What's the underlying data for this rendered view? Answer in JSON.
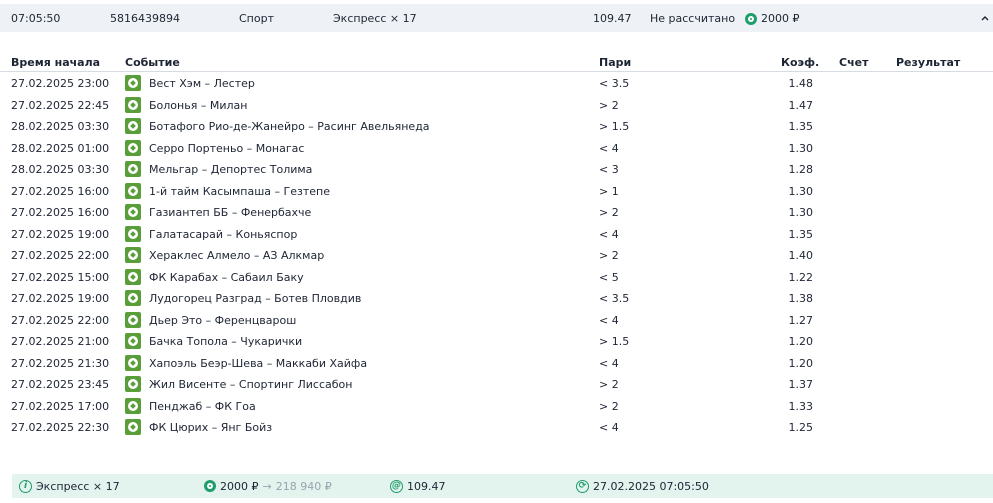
{
  "summary": {
    "time": "07:05:50",
    "bet_id": "5816439894",
    "sport": "Спорт",
    "bet_type": "Экспресс × 17",
    "coef": "109.47",
    "status": "Не рассчитано",
    "stake": "2000 ₽",
    "stake_icon": "coin-icon",
    "collapse_icon": "chevron-up-icon"
  },
  "table": {
    "headers": {
      "time": "Время начала",
      "event": "Событие",
      "bet": "Пари",
      "coef": "Коэф.",
      "score": "Счет",
      "result": "Результат"
    },
    "rows": [
      {
        "time": "27.02.2025 23:00",
        "event": "Вест Хэм – Лестер",
        "bet": "< 3.5",
        "coef": "1.48"
      },
      {
        "time": "27.02.2025 22:45",
        "event": "Болонья – Милан",
        "bet": "> 2",
        "coef": "1.47"
      },
      {
        "time": "28.02.2025 03:30",
        "event": "Ботафого Рио-де-Жанейро – Расинг Авельянеда",
        "bet": "> 1.5",
        "coef": "1.35"
      },
      {
        "time": "28.02.2025 01:00",
        "event": "Серро Портеньо – Монагас",
        "bet": "< 4",
        "coef": "1.30"
      },
      {
        "time": "28.02.2025 03:30",
        "event": "Мельгар – Депортес Толима",
        "bet": "< 3",
        "coef": "1.28"
      },
      {
        "time": "27.02.2025 16:00",
        "event": "1-й тайм Касымпаша – Гезтепе",
        "bet": "> 1",
        "coef": "1.30"
      },
      {
        "time": "27.02.2025 16:00",
        "event": "Газиантеп ББ – Фенербахче",
        "bet": "> 2",
        "coef": "1.30"
      },
      {
        "time": "27.02.2025 19:00",
        "event": "Галатасарай – Коньяспор",
        "bet": "< 4",
        "coef": "1.35"
      },
      {
        "time": "27.02.2025 22:00",
        "event": "Хераклес Алмело – АЗ Алкмар",
        "bet": "> 2",
        "coef": "1.40"
      },
      {
        "time": "27.02.2025 15:00",
        "event": "ФК Карабах – Сабаил Баку",
        "bet": "< 5",
        "coef": "1.22"
      },
      {
        "time": "27.02.2025 19:00",
        "event": "Лудогорец Разград – Ботев Пловдив",
        "bet": "< 3.5",
        "coef": "1.38"
      },
      {
        "time": "27.02.2025 22:00",
        "event": "Дьер Это – Ференцварош",
        "bet": "< 4",
        "coef": "1.27"
      },
      {
        "time": "27.02.2025 21:00",
        "event": "Бачка Топола – Чукарички",
        "bet": "> 1.5",
        "coef": "1.20"
      },
      {
        "time": "27.02.2025 21:30",
        "event": "Хапоэль Беэр-Шева – Маккаби Хайфа",
        "bet": "< 4",
        "coef": "1.20"
      },
      {
        "time": "27.02.2025 23:45",
        "event": "Жил Висенте – Спортинг Лиссабон",
        "bet": "> 2",
        "coef": "1.37"
      },
      {
        "time": "27.02.2025 17:00",
        "event": "Пенджаб – ФК Гоа",
        "bet": "> 2",
        "coef": "1.33"
      },
      {
        "time": "27.02.2025 22:30",
        "event": "ФК Цюрих – Янг Бойз",
        "bet": "< 4",
        "coef": "1.25"
      }
    ]
  },
  "footer": {
    "type": "Экспресс × 17",
    "stake": "2000 ₽",
    "arrow": "→",
    "potential_win": "218 940 ₽",
    "coef": "109.47",
    "datetime": "27.02.2025 07:05:50",
    "type_icon_glyph": "i",
    "coef_icon_glyph": "@",
    "date_icon_glyph": "⟳"
  },
  "colors": {
    "accent": "#1f9d6b",
    "sport_icon": "#5a9e3a",
    "summary_bg": "#eef2f6",
    "footer_bg": "#e3f3ee"
  }
}
